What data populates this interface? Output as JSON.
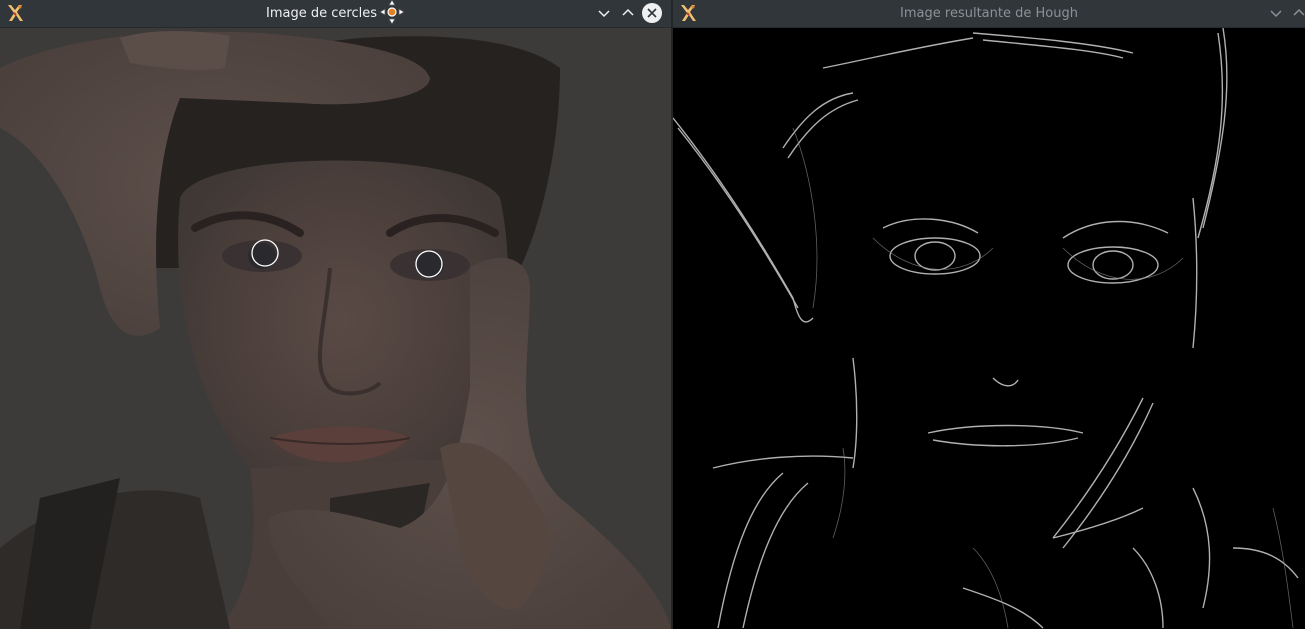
{
  "left_window": {
    "title": "Image de cercles",
    "icon": "app-icon",
    "buttons": [
      "minimize-icon",
      "maximize-icon",
      "close-icon"
    ]
  },
  "right_window": {
    "title": "Image resultante de Hough",
    "icon": "app-icon",
    "buttons": [
      "minimize-icon",
      "maximize-icon"
    ]
  },
  "colors": {
    "titlebar": "#31363b",
    "title_active": "#eff0f1",
    "title_inactive": "#8c9196",
    "detected_circle": "#ffffff",
    "hough_background": "#000000"
  }
}
